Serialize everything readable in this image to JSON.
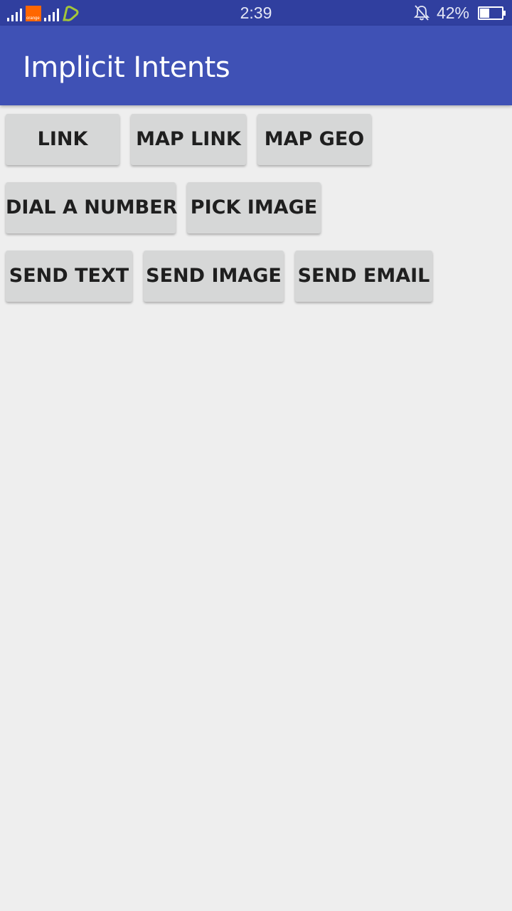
{
  "status_bar": {
    "time": "2:39",
    "battery_percent_text": "42%",
    "battery_level": 0.42,
    "carrier_logo": "orange",
    "icons": [
      "signal-icon",
      "orange-carrier-icon",
      "signal-icon",
      "etisalat-carrier-icon",
      "notifications-off-icon",
      "battery-icon"
    ]
  },
  "app_bar": {
    "title": "Implicit Intents",
    "color": "#3f51b5"
  },
  "buttons": {
    "link": "LINK",
    "map_link": "MAP LINK",
    "map_geo": "MAP GEO",
    "dial_a_number": "DIAL A NUMBER",
    "pick_image": "PICK IMAGE",
    "send_text": "SEND TEXT",
    "send_image": "SEND IMAGE",
    "send_email": "SEND EMAIL"
  }
}
